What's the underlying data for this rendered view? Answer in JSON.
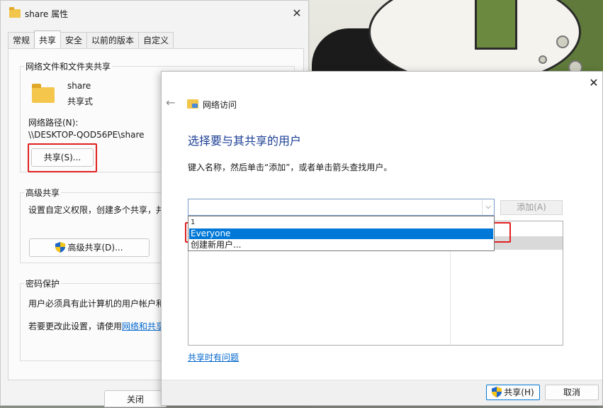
{
  "properties_window": {
    "title": "share 属性",
    "tabs": [
      "常规",
      "共享",
      "安全",
      "以前的版本",
      "自定义"
    ],
    "active_tab": "共享",
    "file_sharing": {
      "group_title": "网络文件和文件夹共享",
      "folder_name": "share",
      "folder_status": "共享式",
      "network_path_label": "网络路径(N):",
      "network_path": "\\\\DESKTOP-QOD56PE\\share",
      "share_button": "共享(S)..."
    },
    "advanced_sharing": {
      "group_title": "高级共享",
      "description": "设置自定义权限，创建多个共享，并",
      "button": "高级共享(D)..."
    },
    "password_protection": {
      "group_title": "密码保护",
      "line1": "用户必须具有此计算机的用户帐户和",
      "line2_prefix": "若要更改此设置，请使用",
      "line2_link": "网络和共享"
    },
    "close_button": "关闭"
  },
  "network_access_dialog": {
    "header_title": "网络访问",
    "heading": "选择要与其共享的用户",
    "description": "键入名称，然后单击“添加”，或者单击箭头查找用户。",
    "add_button": "添加(A)",
    "dropdown_items": [
      "1",
      "Everyone",
      "创建新用户..."
    ],
    "selected_item": "Everyone",
    "problems_link": "共享时有问题",
    "share_button": "共享(H)",
    "cancel_button": "取消"
  },
  "colors": {
    "heading_blue": "#1c3f95",
    "selection_blue": "#0078d7",
    "highlight_red": "#e02020",
    "link_blue": "#0066cc"
  },
  "icons": [
    "folder-icon",
    "close-icon",
    "back-arrow-icon",
    "network-folder-icon",
    "uac-shield-icon",
    "chevron-down-icon"
  ]
}
